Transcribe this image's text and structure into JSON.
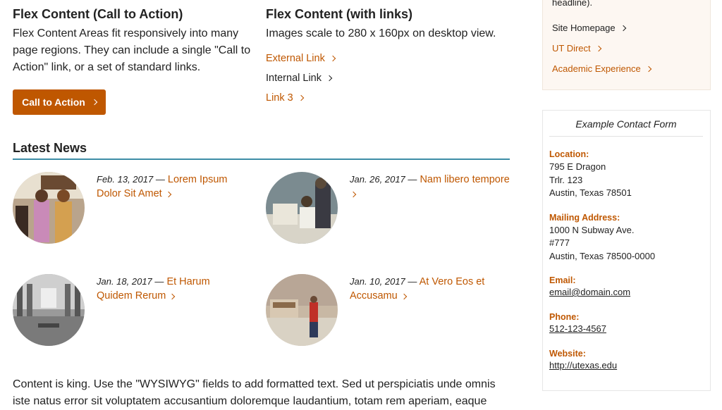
{
  "flex_cta": {
    "heading": "Flex Content (Call to Action)",
    "body": "Flex Content Areas fit responsively into many page regions. They can include a single \"Call to Action\" link, or a set of standard links.",
    "button_label": "Call to Action"
  },
  "flex_links": {
    "heading": "Flex Content (with links)",
    "body": "Images scale to 280 x 160px on desktop view.",
    "links": [
      {
        "label": "External Link"
      },
      {
        "label": "Internal Link"
      },
      {
        "label": "Link 3"
      }
    ]
  },
  "news": {
    "heading": "Latest News",
    "items": [
      {
        "date": "Feb. 13, 2017 —",
        "title": "Lorem Ipsum Dolor Sit Amet"
      },
      {
        "date": "Jan. 26, 2017 —",
        "title": "Nam libero tempore"
      },
      {
        "date": "Jan. 18, 2017 —",
        "title": "Et Harum Quidem Rerum"
      },
      {
        "date": "Jan. 10, 2017 —",
        "title": "At Vero Eos et Accusamu"
      }
    ]
  },
  "content_paragraph": "Content is king. Use the \"WYSIWYG\" fields to add formatted text. Sed ut perspiciatis unde omnis iste natus error sit voluptatem accusantium doloremque laudantium, totam rem aperiam, eaque",
  "sidebar_links": {
    "cut_text": "headline).",
    "links": [
      {
        "label": "Site Homepage"
      },
      {
        "label": "UT Direct"
      },
      {
        "label": "Academic Experience"
      }
    ]
  },
  "contact": {
    "title": "Example Contact Form",
    "location_label": "Location:",
    "location_lines": [
      "795 E Dragon",
      "Trlr. 123",
      "Austin, Texas 78501"
    ],
    "mailing_label": "Mailing Address:",
    "mailing_lines": [
      "1000 N Subway Ave.",
      "#777",
      "Austin, Texas 78500-0000"
    ],
    "email_label": "Email:",
    "email": "email@domain.com",
    "phone_label": "Phone:",
    "phone": "512-123-4567",
    "website_label": "Website:",
    "website": "http://utexas.edu"
  },
  "colors": {
    "accent": "#bf5700",
    "rule": "#3d8da6"
  }
}
